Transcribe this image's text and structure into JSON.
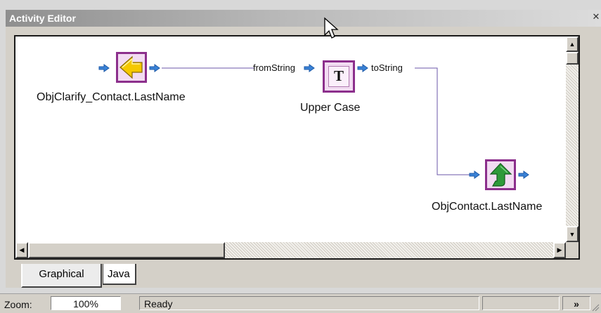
{
  "window": {
    "title": "Activity Editor",
    "close_glyph": "✕"
  },
  "diagram": {
    "source_node": {
      "label": "ObjClarify_Contact.LastName",
      "icon": "yellow-arrow-icon"
    },
    "transform_node": {
      "label": "Upper Case",
      "icon": "text-T-icon",
      "glyph": "T",
      "input_port": "fromString",
      "output_port": "toString"
    },
    "target_node": {
      "label": "ObjContact.LastName",
      "icon": "green-up-arrow-icon"
    },
    "colors": {
      "node_border": "#8c2f8c",
      "connector": "#6b57a8",
      "port": "#3a82d6"
    }
  },
  "tabs": [
    {
      "label": "Graphical",
      "active": true
    },
    {
      "label": "Java",
      "active": false
    }
  ],
  "statusbar": {
    "zoom_label": "Zoom:",
    "zoom_value": "100%",
    "status": "Ready",
    "more_glyph": "»"
  }
}
